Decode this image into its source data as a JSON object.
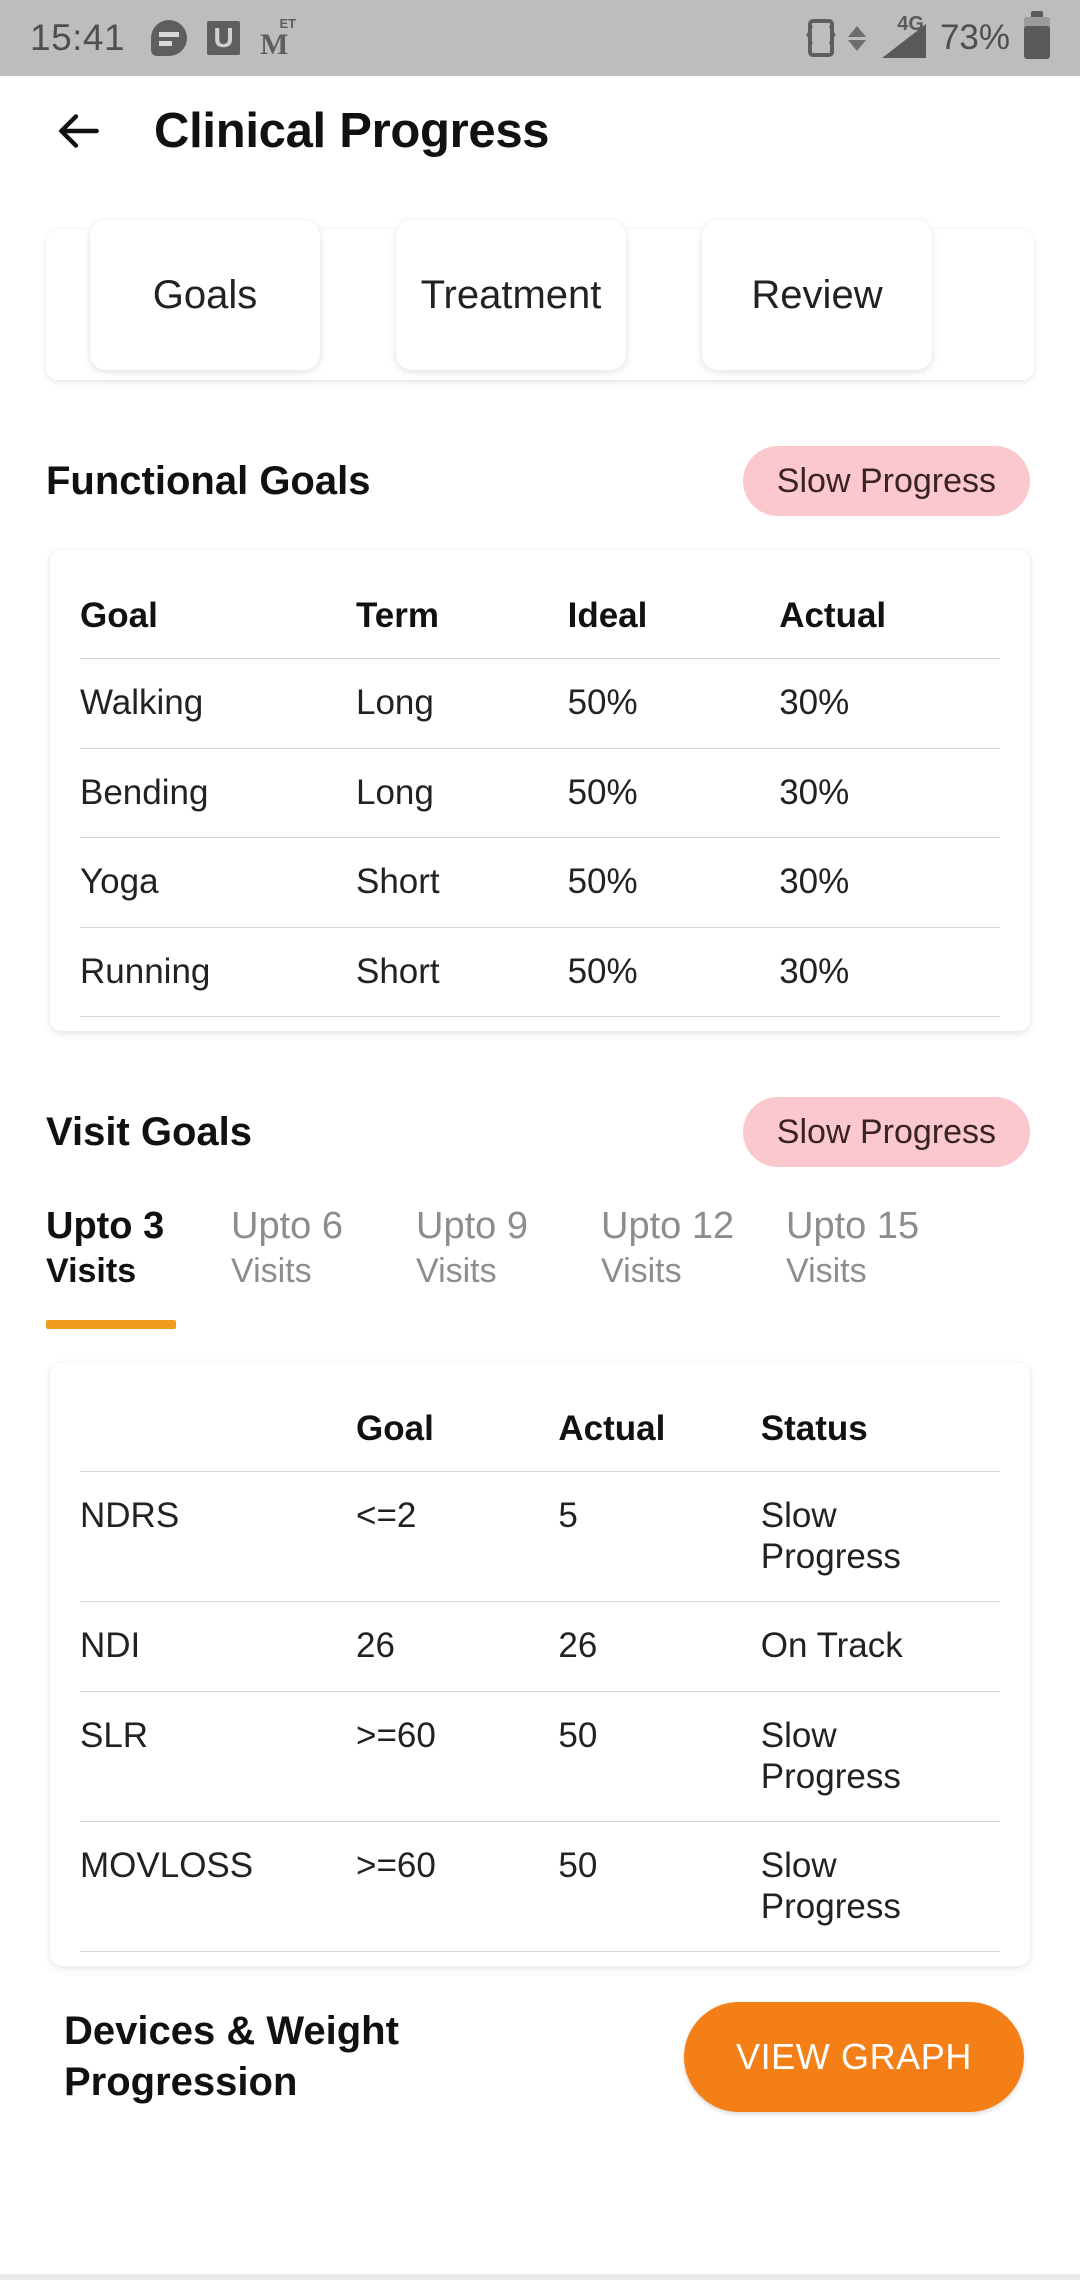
{
  "status_bar": {
    "time": "15:41",
    "battery_percent": "73%",
    "network": "4G",
    "left_icons": [
      "chat-bubble-icon",
      "u-app-icon",
      "economic-times-icon"
    ],
    "right_icons": [
      "vibrate-icon",
      "data-transfer-icon",
      "signal-4g-icon",
      "battery-icon"
    ]
  },
  "app_bar": {
    "back_icon": "back-arrow-icon",
    "title": "Clinical Progress"
  },
  "top_tabs": [
    {
      "label": "Goals"
    },
    {
      "label": "Treatment"
    },
    {
      "label": "Review"
    }
  ],
  "functional_goals": {
    "title": "Functional Goals",
    "badge": "Slow Progress",
    "badge_color": "#fbc9cd",
    "columns": [
      "Goal",
      "Term",
      "Ideal",
      "Actual"
    ],
    "rows": [
      [
        "Walking",
        "Long",
        "50%",
        "30%"
      ],
      [
        "Bending",
        "Long",
        "50%",
        "30%"
      ],
      [
        "Yoga",
        "Short",
        "50%",
        "30%"
      ],
      [
        "Running",
        "Short",
        "50%",
        "30%"
      ]
    ]
  },
  "visit_goals": {
    "title": "Visit Goals",
    "badge": "Slow Progress",
    "badge_color": "#fbc9cd",
    "active_indicator_color": "#f29c1f",
    "tabs": [
      {
        "line1": "Upto 3",
        "line2": "Visits",
        "active": true
      },
      {
        "line1": "Upto 6",
        "line2": "Visits",
        "active": false
      },
      {
        "line1": "Upto 9",
        "line2": "Visits",
        "active": false
      },
      {
        "line1": "Upto 12",
        "line2": "Visits",
        "active": false
      },
      {
        "line1": "Upto 15",
        "line2": "Visits",
        "active": false
      }
    ],
    "columns": [
      "",
      "Goal",
      "Actual",
      "Status"
    ],
    "rows": [
      [
        "NDRS",
        "<=2",
        "5",
        "Slow Progress"
      ],
      [
        "NDI",
        "26",
        "26",
        "On Track"
      ],
      [
        "SLR",
        ">=60",
        "50",
        "Slow Progress"
      ],
      [
        "MOVLOSS",
        ">=60",
        "50",
        "Slow Progress"
      ]
    ]
  },
  "bottom": {
    "title": "Devices & Weight Progression",
    "button_label": "VIEW GRAPH",
    "button_color": "#f57f17"
  }
}
